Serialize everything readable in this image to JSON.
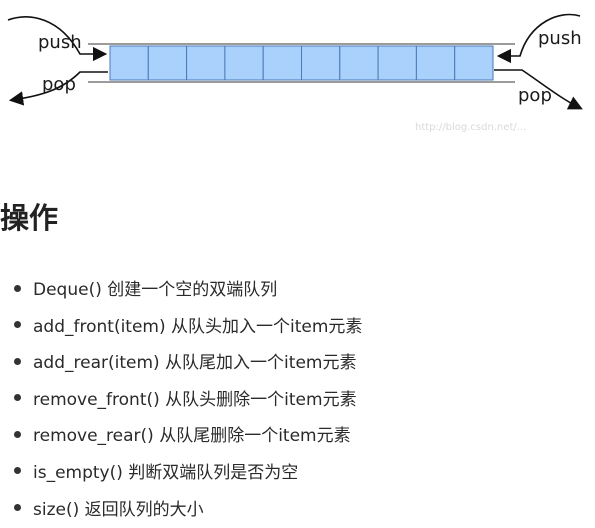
{
  "diagram": {
    "left_push_label": "push",
    "left_pop_label": "pop",
    "right_push_label": "push",
    "right_pop_label": "pop",
    "cell_count": 10,
    "cell_color": "#a9d1fb",
    "watermark": "http://blog.csdn.net/..."
  },
  "heading": "操作",
  "operations": [
    "Deque() 创建一个空的双端队列",
    "add_front(item) 从队头加入一个item元素",
    "add_rear(item) 从队尾加入一个item元素",
    "remove_front() 从队头删除一个item元素",
    "remove_rear() 从队尾删除一个item元素",
    "is_empty() 判断双端队列是否为空",
    "size() 返回队列的大小"
  ]
}
